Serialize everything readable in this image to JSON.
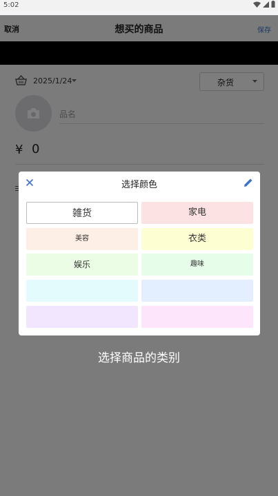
{
  "status_bar": {
    "time": "5:02"
  },
  "header": {
    "cancel_label": "取消",
    "title": "想买的商品",
    "save_label": "保存"
  },
  "form": {
    "date": "2025/1/24",
    "category": "杂货",
    "name_placeholder": "品名",
    "currency_symbol": "¥",
    "price": "0"
  },
  "dialog": {
    "title": "选择颜色",
    "options": [
      {
        "label": "雑货",
        "color": "#ffffff",
        "selected": true
      },
      {
        "label": "家电",
        "color": "#fde2e3"
      },
      {
        "label": "美容",
        "color": "#fdeee6"
      },
      {
        "label": "衣类",
        "color": "#fefed3"
      },
      {
        "label": "娱乐",
        "color": "#ecfde6"
      },
      {
        "label": "趣味",
        "color": "#e6fdea"
      },
      {
        "label": "",
        "color": "#e3fbfd"
      },
      {
        "label": "",
        "color": "#e3effe"
      },
      {
        "label": "",
        "color": "#f1e6fd"
      },
      {
        "label": "",
        "color": "#fde6fb"
      }
    ]
  },
  "caption": "选择商品的类别",
  "colors": {
    "accent": "#3d73c7",
    "overlay": "rgba(0,0,0,0.5)"
  }
}
